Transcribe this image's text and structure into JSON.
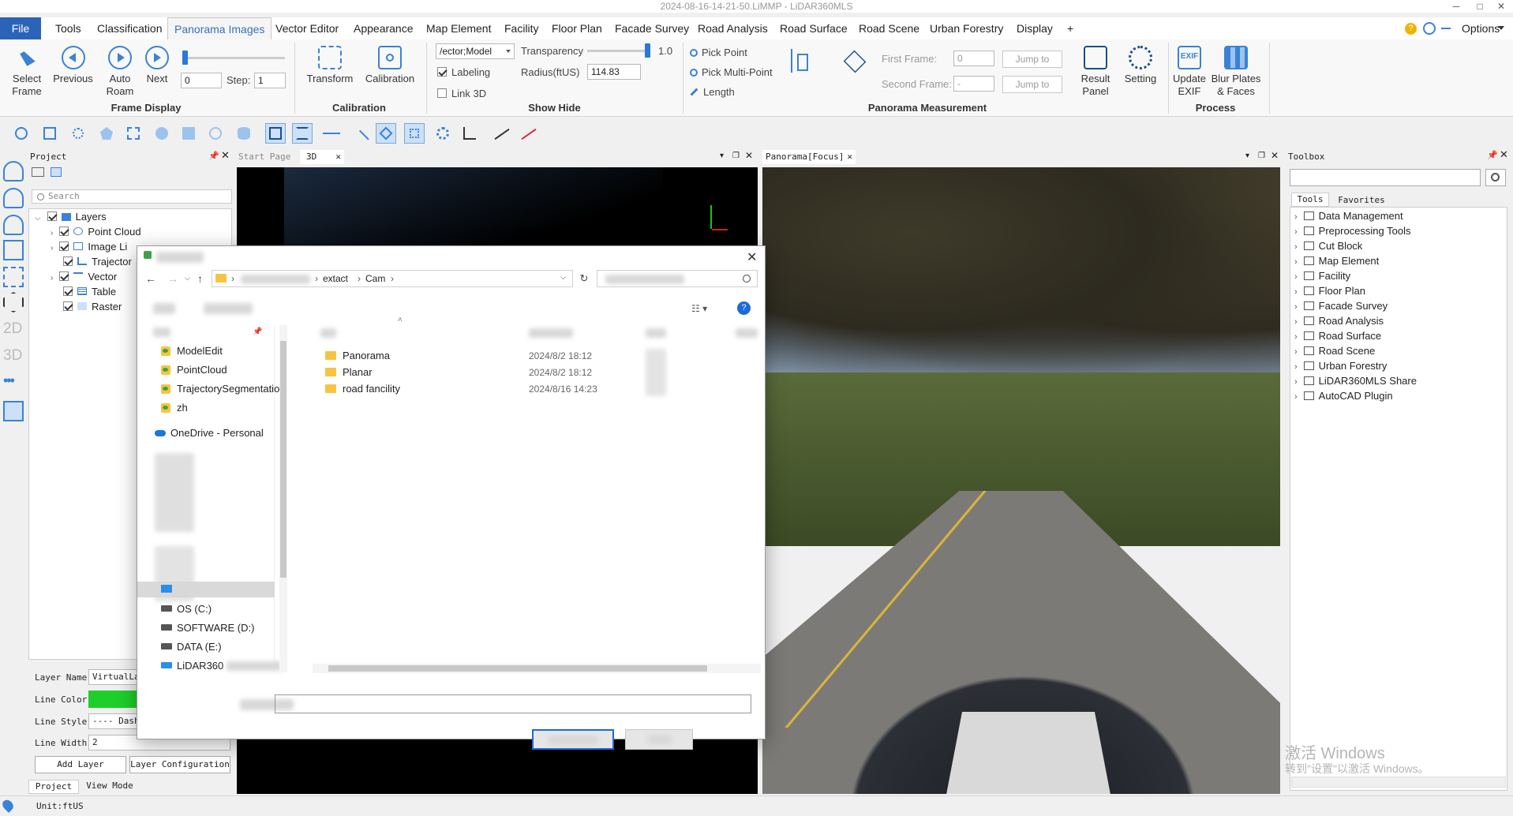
{
  "window": {
    "title": "2024-08-16-14-21-50.LiMMP - LiDAR360MLS",
    "controls": [
      "─",
      "□",
      "✕"
    ]
  },
  "menu": {
    "file": "File",
    "items": [
      "Tools",
      "Classification",
      "Panorama Images",
      "Vector Editor",
      "Appearance",
      "Map Element",
      "Facility",
      "Floor Plan",
      "Facade Survey",
      "Road Analysis",
      "Road Surface",
      "Road Scene",
      "Urban Forestry",
      "Display",
      "+"
    ],
    "active": "Panorama Images",
    "options": "Options"
  },
  "ribbon": {
    "frame_display": {
      "label": "Frame Display",
      "select_frame": "Select\nFrame",
      "previous": "Previous",
      "auto_roam": "Auto\nRoam",
      "next": "Next",
      "frame_value": "0",
      "step_label": "Step:",
      "step_value": "1"
    },
    "calibration": {
      "label": "Calibration",
      "transform": "Transform",
      "calibration": "Calibration"
    },
    "show_hide": {
      "label": "Show Hide",
      "layer_select": "/ector;Model",
      "transparency_label": "Transparency",
      "transparency_value": "1.0",
      "transparency_level": 1.0,
      "labeling": "Labeling",
      "labeling_checked": true,
      "radius_label": "Radius(ftUS)",
      "radius_value": "114.83",
      "link3d": "Link 3D",
      "link3d_checked": false
    },
    "measurement": {
      "label": "Panorama Measurement",
      "pick_point": "Pick Point",
      "pick_multi_point": "Pick Multi-Point",
      "length": "Length",
      "first_frame_label": "First Frame:",
      "first_frame_value": "0",
      "second_frame_label": "Second Frame:",
      "second_frame_value": "-",
      "jump_to_1": "Jump to",
      "jump_to_2": "Jump to",
      "result_panel": "Result\nPanel",
      "setting": "Setting"
    },
    "process": {
      "label": "Process",
      "update_exif": "Update\nEXIF",
      "blur_plates": "Blur Plates\n& Faces"
    }
  },
  "side_icons": [
    "2D",
    "3D",
    "•••"
  ],
  "project_panel": {
    "title": "Project",
    "search_placeholder": "Search",
    "layers_root": "Layers",
    "layers": [
      "Point Cloud",
      "Image Li",
      "Trajector",
      "Vector",
      "Table",
      "Raster"
    ],
    "layer_name_label": "Layer Name",
    "layer_name_value": "VirtualLa",
    "line_color_label": "Line Color",
    "line_color_value": "#1ecf2a",
    "line_style_label": "Line Style",
    "line_style_value": "---- Dash",
    "line_width_label": "Line Width",
    "line_width_value": "2",
    "add_layer": "Add Layer",
    "layer_config": "Layer Configuration",
    "tab_project": "Project",
    "tab_view_mode": "View Mode"
  },
  "status": {
    "unit": "Unit:ftUS"
  },
  "view_tabs": {
    "start_page": "Start Page",
    "tab_3d": "3D",
    "pano": "Panorama[Focus]"
  },
  "toolbox": {
    "title": "Toolbox",
    "tab_tools": "Tools",
    "tab_favorites": "Favorites",
    "items": [
      "Data Management",
      "Preprocessing Tools",
      "Cut Block",
      "Map Element",
      "Facility",
      "Floor Plan",
      "Facade Survey",
      "Road Analysis",
      "Road Surface",
      "Road Scene",
      "Urban Forestry",
      "LiDAR360MLS Share",
      "AutoCAD Plugin"
    ]
  },
  "watermark": {
    "line1": "激活 Windows",
    "line2": "转到\"设置\"以激活 Windows。"
  },
  "dialog": {
    "breadcrumb": [
      "extact",
      "Cam"
    ],
    "nav_items": [
      "ModelEdit",
      "PointCloud",
      "TrajectorySegmentation",
      "zh"
    ],
    "onedrive": "OneDrive - Personal",
    "drives": [
      "OS (C:)",
      "SOFTWARE (D:)",
      "DATA (E:)",
      "LiDAR360"
    ],
    "files": [
      {
        "name": "Panorama",
        "date": "2024/8/2 18:12"
      },
      {
        "name": "Planar",
        "date": "2024/8/2 18:12"
      },
      {
        "name": "road fancility",
        "date": "2024/8/16 14:23"
      }
    ]
  },
  "colors": {
    "accent": "#2b63b8",
    "file_tab": "#2b63b8",
    "icon_blue": "#3b82d6"
  }
}
